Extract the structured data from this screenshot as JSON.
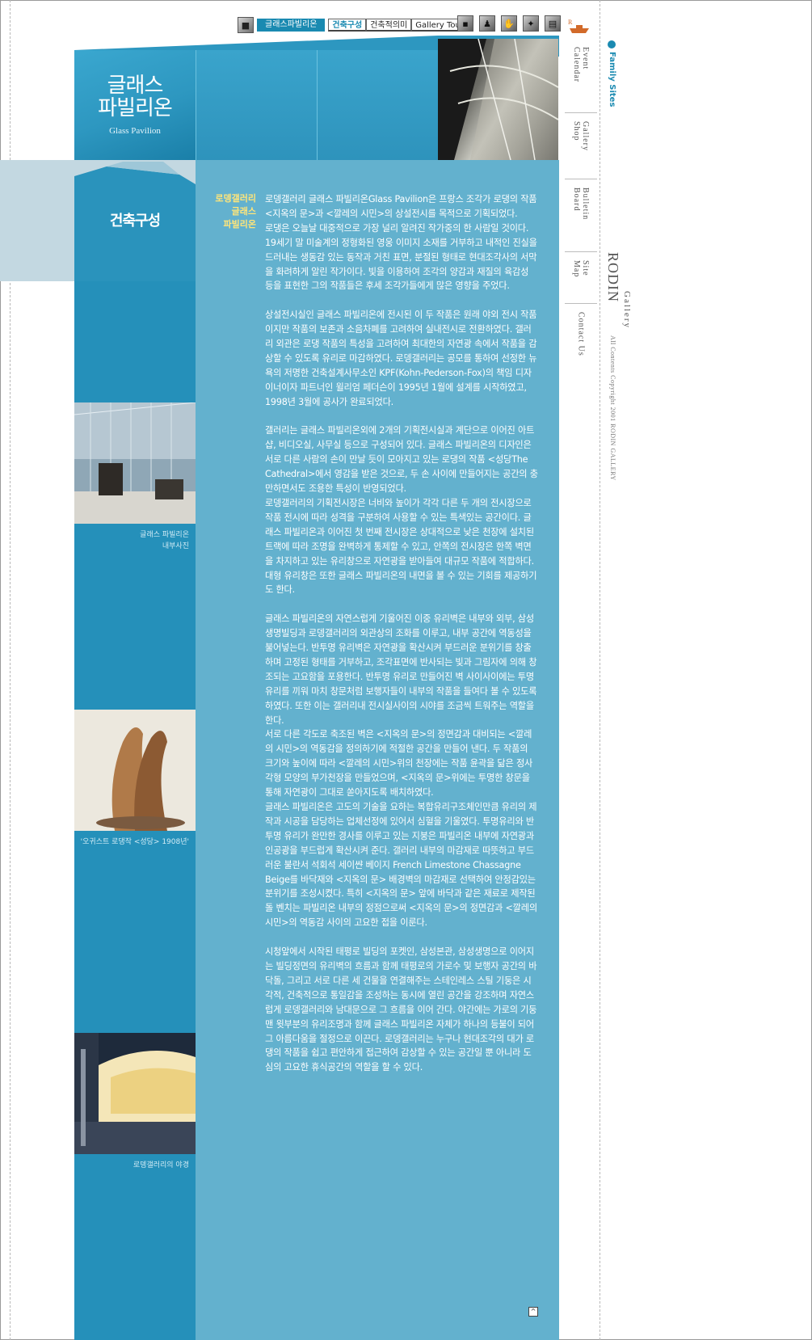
{
  "nav": {
    "current": "글래스파빌리온",
    "tabs": [
      "건축구성",
      "건축적의미",
      "Gallery Tour"
    ],
    "icons": [
      "photo-icon",
      "figure-icon",
      "hand-icon",
      "sculpture-icon",
      "gallery-icon"
    ]
  },
  "header": {
    "logo_title": "글래스\n파빌리온",
    "logo_subtitle": "Glass Pavilion"
  },
  "section": {
    "title": "건축구성"
  },
  "body": {
    "label": "로뎅갤러리\n글래스\n파빌리온",
    "paragraphs": [
      "로뎅갤러리 글래스 파빌리온Glass Pavilion은 프랑스 조각가 로댕의 작품 <지옥의 문>과 <깔레의 시민>의 상설전시를 목적으로 기획되었다.",
      "로댕은 오늘날 대중적으로 가장 널리 알려진 작가중의 한 사람일 것이다. 19세기 말 미술계의 정형화된 영웅 이미지 소재를 거부하고 내적인 진실을 드러내는 생동감 있는 동작과 거친 표면, 분절된 형태로 현대조각사의 서막을 화려하게 알린 작가이다. 빛을 이용하여 조각의 양감과 재질의 육감성 등을 표현한 그의 작품들은 후세 조각가들에게 많은 영향을 주었다.",
      "",
      "상설전시실인 글래스 파빌리온에 전시된 이 두 작품은 원래 야외 전시 작품이지만 작품의 보존과 소음차폐를 고려하여 실내전시로 전환하였다. 갤러리 외관은 로댕 작품의 특성을 고려하여 최대한의 자연광 속에서 작품을 감상할 수 있도록 유리로 마감하였다. 로뎅갤러리는 공모를 통하여 선정한 뉴욕의 저명한 건축설계사무소인 KPF(Kohn-Pederson-Fox)의 책임 디자이너이자 파트너인 윌리엄 페더슨이 1995년 1월에 설계를 시작하였고, 1998년 3월에 공사가 완료되었다.",
      "",
      "갤러리는 글래스 파빌리온외에 2개의 기획전시실과 계단으로 이어진 아트 샵, 비디오실, 사무실 등으로 구성되어 있다. 글래스 파빌리온의 디자인은 서로 다른 사람의 손이 만날 듯이 모아지고 있는 로댕의 작품 <성당The Cathedral>에서 영감을 받은 것으로, 두 손 사이에 만들어지는 공간의 충만하면서도 조용한 특성이 반영되었다.",
      "로뎅갤러리의 기획전시장은 너비와 높이가 각각 다른 두 개의 전시장으로 작품 전시에 따라 성격을 구분하여 사용할 수 있는 특색있는 공간이다. 글래스 파빌리온과 이어진 첫 번째 전시장은 상대적으로 낮은 천장에 설치된 트랙에 따라 조명을 완벽하게 통제할 수 있고, 안쪽의 전시장은 한쪽 벽면을 차지하고 있는 유리창으로 자연광을 받아들여 대규모 작품에 적합하다. 대형 유리창은 또한 글래스 파빌리온의 내면을 볼 수 있는 기회를 제공하기도 한다.",
      "",
      "글래스 파빌리온의 자연스럽게 기울어진 이중 유리벽은 내부와 외부, 삼성생명빌딩과 로뎅갤러리의 외관상의 조화를 이루고, 내부 공간에 역동성을 불어넣는다. 반투명 유리벽은 자연광을 확산시켜 부드러운 분위기를 창출하며 고정된 형태를 거부하고, 조각표면에 반사되는 빛과 그림자에 의해 창조되는 고요함을 포용한다. 반투명 유리로 만들어진 벽 사이사이에는 투명유리를 끼워 마치 창문처럼 보행자들이 내부의 작품을 들여다 볼 수 있도록 하였다. 또한 이는 갤러리내 전시실사이의 시야를 조금씩 트워주는 역할을 한다.",
      "서로 다른 각도로 축조된 벽은 <지옥의 문>의 정면감과 대비되는 <깔레의 시민>의 역동감을 정의하기에 적절한 공간을 만들어 낸다. 두 작품의 크기와 높이에 따라 <깔레의 시민>위의 천장에는 작품 윤곽을 닮은 정사각형 모양의 부가천장을 만들었으며, <지옥의 문>위에는 투명한 창문을 통해 자연광이 그대로 쏟아지도록 배치하였다.",
      "글래스 파빌리온은 고도의 기술을 요하는 복합유리구조체인만큼 유리의 제작과 시공을 담당하는 업체선정에 있어서 심혈을 기울였다. 투명유리와 반투명 유리가 완만한 경사를 이루고 있는 지붕은 파빌리온 내부에 자연광과 인공광을 부드럽게 확산시켜 준다. 갤러리 내부의 마감재로 따뜻하고 부드러운 불란서 석회석 세이쌴 베이지 French Limestone Chassagne Beige를 바닥재와 <지옥의 문> 배경벽의 마감재로 선택하여 안정감있는 분위기를 조성시켰다. 특히 <지옥의 문> 앞에 바닥과 같은 재료로 제작된 돌 벤치는 파빌리온 내부의 정점으로써 <지옥의 문>의 정면감과 <깔레의 시민>의 역동감 사이의 고요한 접을 이룬다.",
      "",
      "시청앞에서 시작된 태평로 빌딩의 포켓인, 삼성본관, 삼성생명으로 이어지는 빌딩정면의 유리벽의 흐름과 함께 태평로의 가로수 및 보행자 공간의 바닥돌, 그리고 서로 다른 세 건물을 연결해주는 스테인레스 스틸 기둥은 시각적, 건축적으로 통일감을 조성하는 동시에 열린 공간을 강조하며 자연스럽게 로뎅갤러리와 남대문으로 그 흐름을 이어 간다. 야간에는 가로의 기둥맨 윗부분의 유리조명과 함께 글래스 파빌리온 자체가 하나의 등불이 되어 그 아름다움을 절정으로 이끈다. 로뎅갤러리는 누구나 현대조각의 대가 로댕의 작품을 쉽고 편안하게 접근하여 감상할 수 있는 공간일 뿐 아니라 도심의 고요한 휴식공간의 역할을 할 수 있다."
    ]
  },
  "side_photos": [
    {
      "caption": "글래스 파빌리온\n내부사진"
    },
    {
      "caption": "'오귀스트 로댕작 <성당> 1908년'"
    },
    {
      "caption": "로뎅갤러리의 야경"
    }
  ],
  "right_menu": {
    "items": [
      "Event Calendar",
      "Gallery Shop",
      "Bulletin Board",
      "Site Map",
      "Contact Us"
    ],
    "family_sites": "Family Sites",
    "logo": "RODIN",
    "logo_sub": "Gallery",
    "copyright": "All Contents Copyright 2001 RODIN GALLERY"
  },
  "colors": {
    "panel": "#63b1ce",
    "dark_panel": "#2590ba",
    "accent": "#1a8ab1",
    "label": "#ffe57a"
  },
  "top_button": "^"
}
